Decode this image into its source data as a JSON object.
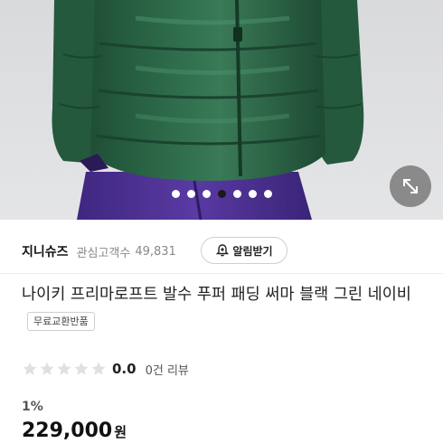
{
  "product_image": {
    "slide_count": 7,
    "active_slide": 4,
    "expand_icon": "expand-diagonal-icon",
    "colors": {
      "background": "#e2e3e5",
      "jacket_green": "#2d6a4a",
      "pants_purple": "#4b2f8f"
    }
  },
  "seller": {
    "name": "지니슈즈",
    "interest_label": "관심고객수",
    "interest_count": "49,831",
    "alert_label": "알림받기",
    "alert_icon": "bell-plus-icon"
  },
  "product": {
    "title": "나이키 프리마로프트 발수 푸퍼 패딩 써마 블랙 그린 네이비",
    "policy_badge": "무료교환반품"
  },
  "rating": {
    "stars": 0,
    "max_stars": 5,
    "score": "0.0",
    "review_text": "0건 리뷰"
  },
  "price": {
    "discount": "1%",
    "amount": "229,000",
    "unit": "원"
  }
}
